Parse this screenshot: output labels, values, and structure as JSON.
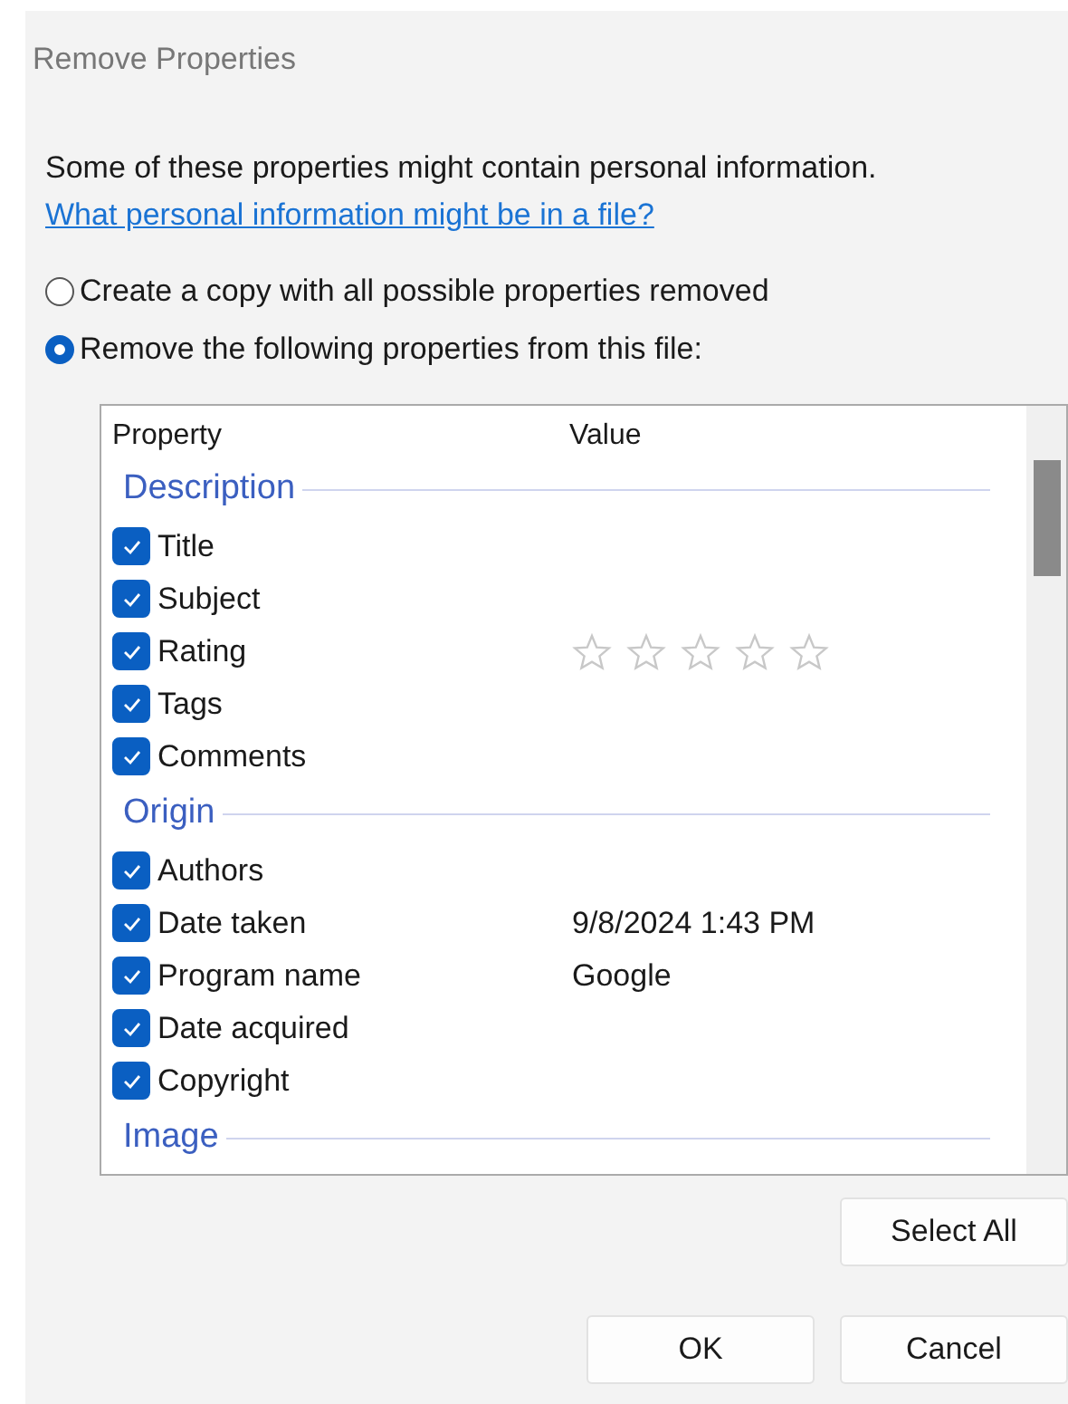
{
  "window": {
    "title": "Remove Properties"
  },
  "intro": "Some of these properties might contain personal information.",
  "help_link": "What personal information might be in a file?",
  "options": [
    {
      "label": "Create a copy with all possible properties removed",
      "selected": false
    },
    {
      "label": "Remove the following properties from this file:",
      "selected": true
    }
  ],
  "table": {
    "columns": [
      "Property",
      "Value"
    ],
    "rows": [
      {
        "kind": "group",
        "label": "Description"
      },
      {
        "kind": "property",
        "label": "Title",
        "checked": true
      },
      {
        "kind": "property",
        "label": "Subject",
        "checked": true
      },
      {
        "kind": "property",
        "label": "Rating",
        "checked": true,
        "stars": 0
      },
      {
        "kind": "property",
        "label": "Tags",
        "checked": true
      },
      {
        "kind": "property",
        "label": "Comments",
        "checked": true
      },
      {
        "kind": "group",
        "label": "Origin"
      },
      {
        "kind": "property",
        "label": "Authors",
        "checked": true
      },
      {
        "kind": "property",
        "label": "Date taken",
        "checked": true,
        "value": "9/8/2024 1:43 PM"
      },
      {
        "kind": "property",
        "label": "Program name",
        "checked": true,
        "value": "Google"
      },
      {
        "kind": "property",
        "label": "Date acquired",
        "checked": true
      },
      {
        "kind": "property",
        "label": "Copyright",
        "checked": true
      },
      {
        "kind": "group",
        "label": "Image"
      }
    ]
  },
  "buttons": {
    "select_all": "Select All",
    "ok": "OK",
    "cancel": "Cancel"
  }
}
